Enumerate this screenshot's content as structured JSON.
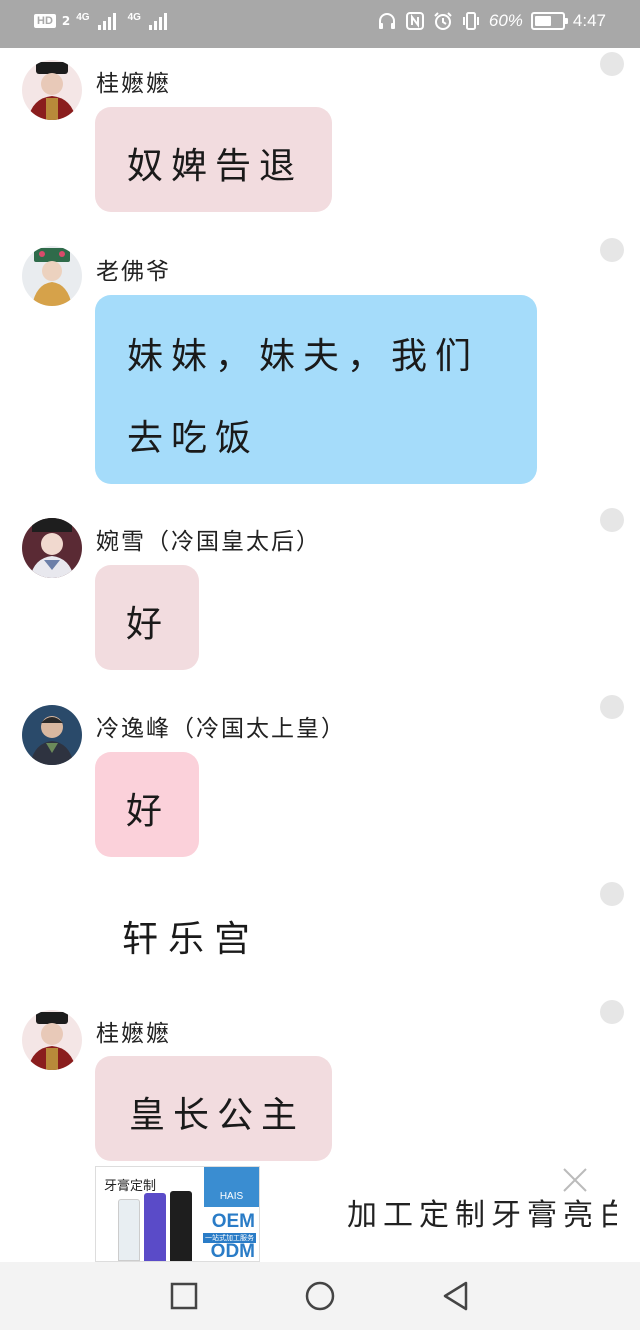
{
  "status_bar": {
    "hd": "HD",
    "sim1": "2",
    "net1": "4G",
    "net2": "4G",
    "battery_percent": "60%",
    "battery_level": 0.6,
    "time": "4:47",
    "icons": [
      "headphones-icon",
      "nfc-icon",
      "alarm-icon",
      "vibrate-icon",
      "battery-icon"
    ]
  },
  "messages": [
    {
      "sender": "桂嬷嬷",
      "text": "奴婢告退",
      "bubble_color": "#f2dcdf"
    },
    {
      "sender": "老佛爷",
      "text_line1": "妹妹，妹夫，我们",
      "text_line2": "去吃饭",
      "bubble_color": "#a5dcfa"
    },
    {
      "sender": "婉雪（冷国皇太后）",
      "text": "好",
      "bubble_color": "#f2dcdf"
    },
    {
      "sender": "冷逸峰（冷国太上皇）",
      "text": "好",
      "bubble_color": "#fbd1da"
    },
    {
      "sender": "桂嬷嬷",
      "text": "皇长公主",
      "bubble_color": "#f2dcdf"
    }
  ],
  "narration": "轩乐宫",
  "ad": {
    "image_tag": "牙膏定制",
    "brand": "HAIS",
    "oem": "OEM",
    "odm": "ODM",
    "sub": "一站式加工服务",
    "title": "加工定制牙膏亮白",
    "close_icon": "close-icon"
  },
  "nav_bar": {
    "icons": [
      "recents-square-icon",
      "home-circle-icon",
      "back-triangle-icon"
    ]
  }
}
